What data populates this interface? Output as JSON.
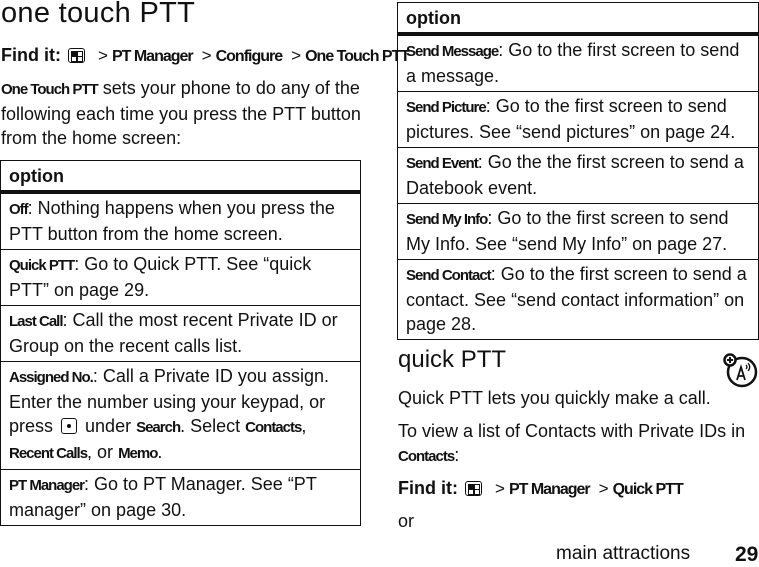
{
  "left": {
    "title": "one touch PTT",
    "find_it": {
      "label": "Find it:",
      "icon": "menu-key-icon",
      "path": [
        "PT Manager",
        "Configure",
        "One Touch PTT"
      ]
    },
    "intro": {
      "term": "One Touch PTT",
      "text": " sets your phone to do any of the following each time you press the PTT button from the home screen:"
    },
    "table": {
      "header": "option",
      "rows": [
        {
          "term": "Off",
          "text": ": Nothing happens when you press the PTT button from the home screen."
        },
        {
          "term": "Quick PTT",
          "text": ": Go to Quick PTT. See “quick PTT” on page 29."
        },
        {
          "term": "Last Call",
          "text": ": Call the most recent Private ID or Group on the recent calls list."
        },
        {
          "term": "Assigned No.",
          "text_a": ": Call a Private ID you assign. Enter the number using your keypad, or press ",
          "icon": "center-key-icon",
          "text_b": " under ",
          "term_b": "Search",
          "text_c": ". Select ",
          "term_c": "Contacts",
          "text_d": ", ",
          "term_d": "Recent Calls",
          "text_e": ", or ",
          "term_e": "Memo",
          "text_f": "."
        },
        {
          "term": "PT Manager",
          "text": ": Go to PT Manager. See “PT manager” on page 30."
        }
      ]
    }
  },
  "right": {
    "table": {
      "header": "option",
      "rows": [
        {
          "term": "Send Message",
          "text": ": Go to the first screen to send a message."
        },
        {
          "term": "Send Picture",
          "text": ": Go to the first screen to send pictures. See “send pictures” on page 24."
        },
        {
          "term": "Send Event",
          "text": ": Go the the first screen to send a Datebook event."
        },
        {
          "term": "Send My Info",
          "text": ": Go to the first screen to send My Info. See “send My Info” on page 27."
        },
        {
          "term": "Send Contact",
          "text": ": Go to the first screen to send a contact. See “send contact information” on page 28."
        }
      ]
    },
    "section_title": "quick PTT",
    "section_icon": "ptt-feature-icon",
    "para1": "Quick PTT lets you quickly make a call.",
    "para2": {
      "text": "To view a list of Contacts with Private IDs in ",
      "term": "Contacts",
      "end": ":"
    },
    "find_it": {
      "label": "Find it:",
      "icon": "menu-key-icon",
      "path": [
        "PT Manager",
        "Quick PTT"
      ]
    },
    "or": "or"
  },
  "footer": {
    "section": "main attractions",
    "page_number": "29"
  }
}
